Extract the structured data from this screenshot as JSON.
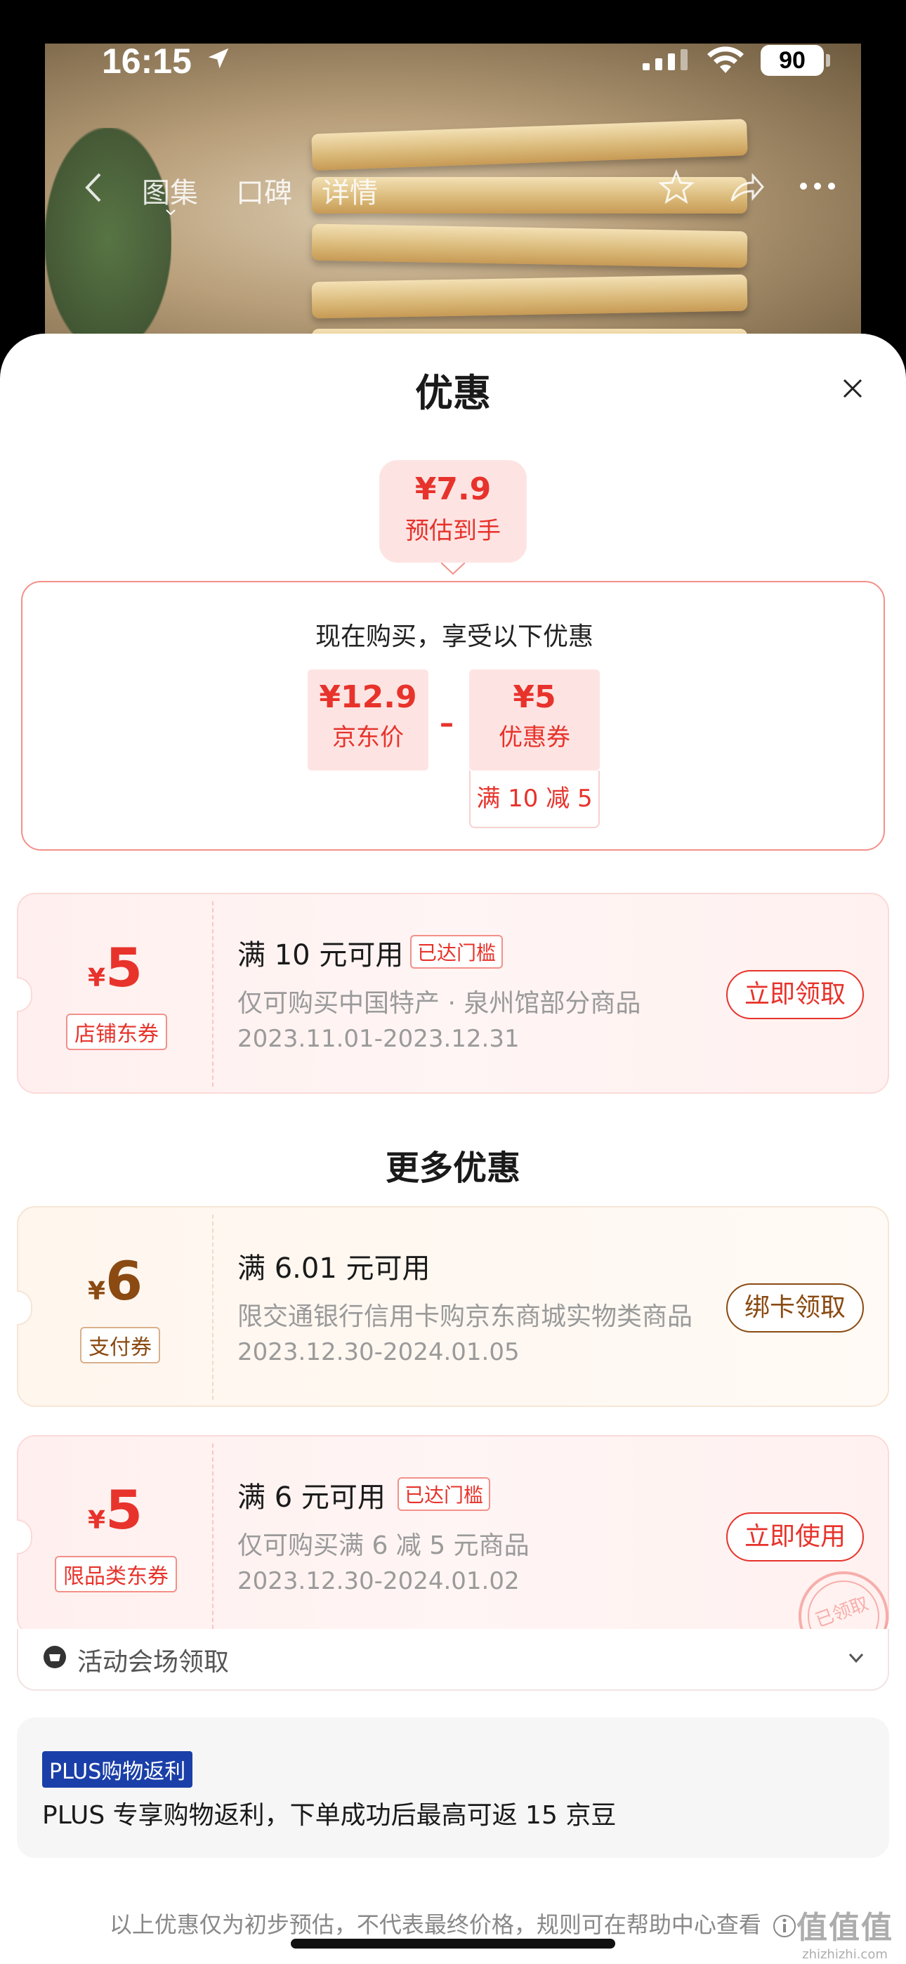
{
  "status_bar": {
    "time": "16:15",
    "battery": "90"
  },
  "nav": {
    "tabs": [
      "图集",
      "口碑",
      "详情"
    ]
  },
  "sheet": {
    "title": "优惠",
    "estimate": {
      "price": "¥7.9",
      "label": "预估到手"
    },
    "calc": {
      "heading": "现在购买，享受以下优惠",
      "jd_price": {
        "value": "¥12.9",
        "label": "京东价"
      },
      "minus": "–",
      "coupon": {
        "value": "¥5",
        "label": "优惠券"
      },
      "rule": "满 10 减 5"
    },
    "coupons": [
      {
        "currency": "¥",
        "amount": "5",
        "type": "店铺东券",
        "condition": "满 10 元可用",
        "reached": "已达门槛",
        "desc": "仅可购买中国特产 · 泉州馆部分商品",
        "dates": "2023.11.01-2023.12.31",
        "button": "立即领取"
      }
    ],
    "more_title": "更多优惠",
    "more_coupons": [
      {
        "currency": "¥",
        "amount": "6",
        "type": "支付券",
        "condition": "满 6.01 元可用",
        "reached": "",
        "desc": "限交通银行信用卡购京东商城实物类商品",
        "dates": "2023.12.30-2024.01.05",
        "button": "绑卡领取"
      },
      {
        "currency": "¥",
        "amount": "5",
        "type": "限品类东券",
        "condition": "满 6 元可用",
        "reached": "已达门槛",
        "desc": "仅可购买满 6 减 5 元商品",
        "dates": "2023.12.30-2024.01.02",
        "button": "立即使用",
        "stamp": "已领取"
      }
    ],
    "venue": {
      "label": "活动会场领取"
    },
    "plus": {
      "badge": "PLUS购物返利",
      "text": "PLUS 专享购物返利，下单成功后最高可返 15 京豆"
    },
    "footnote": "以上优惠仅为初步预估，不代表最终价格，规则可在帮助中心查看"
  },
  "watermark": {
    "big": "值值值",
    "small": "zhizhizhi.com"
  },
  "colors": {
    "accent_red": "#e7332b",
    "gold": "#8a4a12",
    "plus_blue": "#1a3fa8"
  }
}
